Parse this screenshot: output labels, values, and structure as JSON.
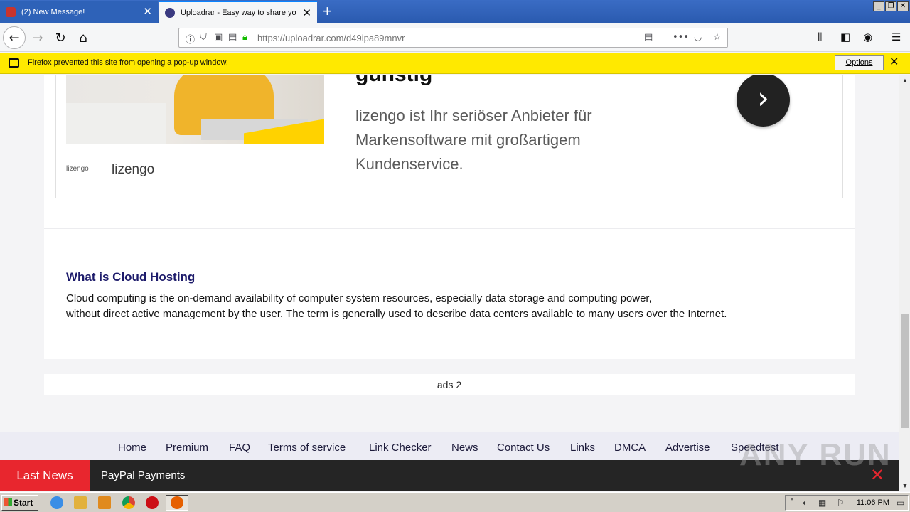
{
  "browser": {
    "tabs": [
      {
        "title": "(2) New Message!",
        "active": false
      },
      {
        "title": "Uploadrar - Easy way to share yo",
        "active": true
      }
    ],
    "new_tab_icon": "plus-icon",
    "url": "https://uploadrar.com/d49ipa89mnvr",
    "popup_notice": "Firefox prevented this site from opening a pop-up window.",
    "popup_options_label": "Options"
  },
  "ad": {
    "headline": "günstig",
    "body_lines": [
      "lizengo ist Ihr seriöser Anbieter für",
      "Markensoftware mit großartigem",
      "Kundenservice."
    ],
    "logo_text": "lizengo",
    "brand": "lizengo",
    "next_icon": "chevron-right-icon",
    "colors": {
      "accent": "#ffd200",
      "next_bg": "#222222"
    }
  },
  "info": {
    "title": "What is Cloud Hosting",
    "lines": [
      "Cloud computing is the on-demand availability of computer system resources, especially data storage and computing power,",
      "without direct active management by the user. The term is generally used to describe data centers available to many users over the Internet."
    ]
  },
  "ads2_label": "ads 2",
  "footer_links": [
    "Home",
    "Premium",
    "FAQ",
    "Terms of service",
    "Link Checker",
    "News",
    "Contact Us",
    "Links",
    "DMCA",
    "Advertise",
    "Speedtest"
  ],
  "news": {
    "label": "Last News",
    "item": "PayPal Payments",
    "colors": {
      "label_bg": "#e8262e",
      "bar_bg": "#252525"
    }
  },
  "watermark": "ANY RUN",
  "taskbar": {
    "start_label": "Start",
    "clock": "11:06 PM"
  }
}
